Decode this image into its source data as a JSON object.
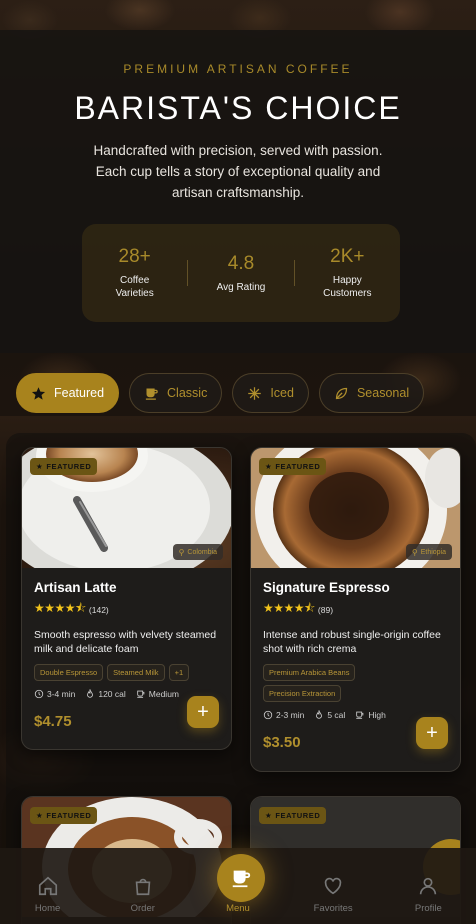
{
  "hero": {
    "eyebrow": "PREMIUM ARTISAN COFFEE",
    "title": "BARISTA'S CHOICE",
    "subtitle": "Handcrafted with precision, served with passion. Each cup tells a story of exceptional quality and artisan craftsmanship."
  },
  "stats": [
    {
      "value": "28+",
      "label": "Coffee Varieties"
    },
    {
      "value": "4.8",
      "label": "Avg Rating"
    },
    {
      "value": "2K+",
      "label": "Happy Customers"
    }
  ],
  "tabs": [
    {
      "label": "Featured",
      "icon": "star-icon",
      "active": true
    },
    {
      "label": "Classic",
      "icon": "cup-icon"
    },
    {
      "label": "Iced",
      "icon": "snowflake-icon"
    },
    {
      "label": "Seasonal",
      "icon": "leaf-icon"
    }
  ],
  "products": [
    {
      "badge": "FEATURED",
      "origin": "Colombia",
      "name": "Artisan Latte",
      "rating_count": "(142)",
      "stars": 4.5,
      "description": "Smooth espresso with velvety steamed milk and delicate foam",
      "tags": [
        "Double Espresso",
        "Steamed Milk",
        "+1"
      ],
      "time": "3-4 min",
      "calories": "120 cal",
      "strength": "Medium",
      "price": "$4.75"
    },
    {
      "badge": "FEATURED",
      "origin": "Ethiopia",
      "name": "Signature Espresso",
      "rating_count": "(89)",
      "stars": 4.5,
      "description": "Intense and robust single-origin coffee shot with rich crema",
      "tags": [
        "Premium Arabica Beans",
        "Precision Extraction"
      ],
      "time": "2-3 min",
      "calories": "5 cal",
      "strength": "High",
      "price": "$3.50"
    },
    {
      "badge": "FEATURED"
    },
    {
      "badge": "FEATURED"
    }
  ],
  "nav": [
    {
      "label": "Home",
      "icon": "home-icon"
    },
    {
      "label": "Order",
      "icon": "bag-icon"
    },
    {
      "label": "Menu",
      "icon": "cup-icon",
      "active": true
    },
    {
      "label": "Favorites",
      "icon": "heart-icon"
    },
    {
      "label": "Profile",
      "icon": "user-icon"
    }
  ],
  "colors": {
    "accent": "#a8831d",
    "star": "#f2c31b",
    "card": "#1e1c1a"
  }
}
